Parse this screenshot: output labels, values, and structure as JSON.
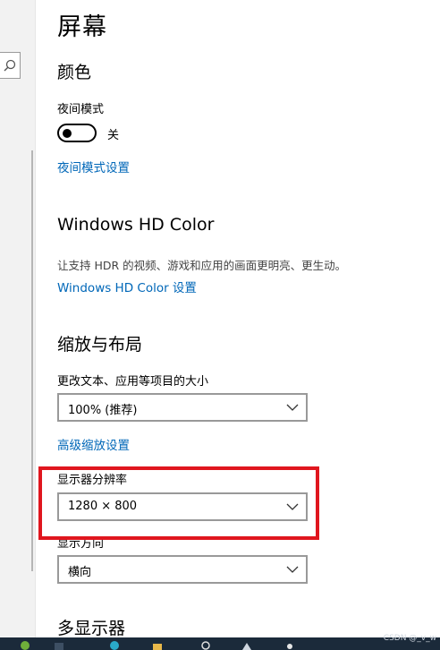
{
  "page": {
    "title": "屏幕"
  },
  "color_section": {
    "heading": "颜色",
    "night_light_label": "夜间模式",
    "night_light_state": "关",
    "night_light_on": false,
    "night_light_settings_link": "夜间模式设置"
  },
  "hd_color_section": {
    "heading": "Windows HD Color",
    "description": "让支持 HDR 的视频、游戏和应用的画面更明亮、更生动。",
    "settings_link": "Windows HD Color 设置"
  },
  "scale_layout_section": {
    "heading": "缩放与布局",
    "scale_label": "更改文本、应用等项目的大小",
    "scale_value": "100% (推荐)",
    "advanced_scaling_link": "高级缩放设置",
    "resolution_label": "显示器分辨率",
    "resolution_value": "1280 × 800",
    "orientation_label": "显示方向",
    "orientation_value": "横向"
  },
  "multi_display_section": {
    "heading": "多显示器"
  },
  "watermark": "CSDN @_v_w",
  "colors": {
    "link": "#0067b8",
    "highlight": "#e0161e",
    "taskbar": "#1b2a3a"
  },
  "icons": {
    "search": "search-icon",
    "dropdown": "chevron-down-icon"
  }
}
